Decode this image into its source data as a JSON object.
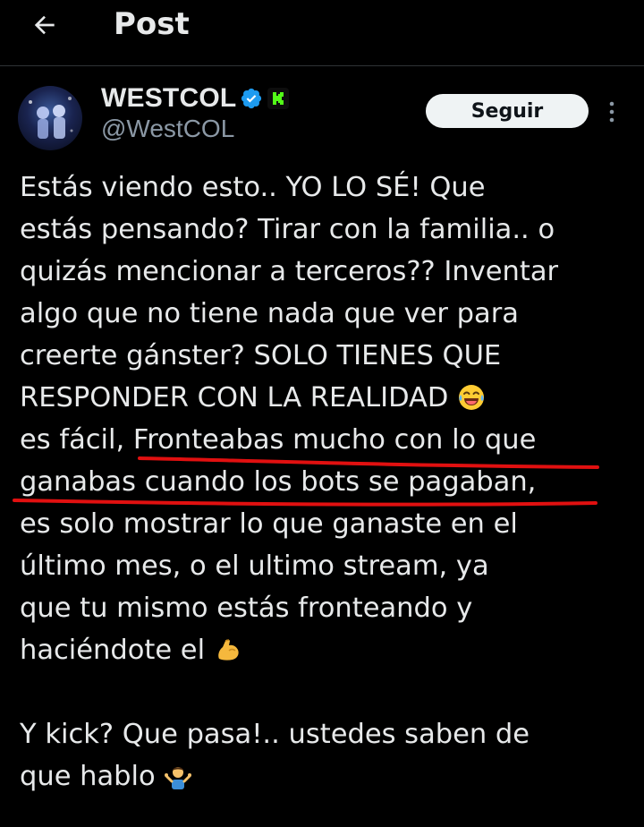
{
  "header": {
    "title": "Post"
  },
  "author": {
    "name": "WESTCOL",
    "handle": "@WestCOL",
    "follow_label": "Seguir"
  },
  "tweet": {
    "lines": [
      "Estás viendo esto.. YO LO SÉ! Que",
      "estás pensando? Tirar con la familia.. o",
      "quizás mencionar a terceros?? Inventar",
      "algo que no tiene nada que ver para",
      "creerte gánster? SOLO TIENES QUE",
      "RESPONDER CON LA REALIDAD",
      "es fácil, Fronteabas mucho con lo que",
      "ganabas cuando los bots se pagaban,",
      "es solo mostrar lo que ganaste en el",
      "último mes, o el ultimo stream, ya",
      "que tu mismo estás fronteando y",
      "haciéndote el",
      "",
      "Y kick? Que pasa!.. ustedes saben de",
      "que hablo"
    ]
  },
  "icons": {
    "back": "arrow-left-icon",
    "verified": "verified-badge-icon",
    "kick": "kick-logo-icon",
    "more": "more-vertical-icon",
    "emoji_laugh": "tears-of-joy-emoji",
    "emoji_muscle": "flexed-biceps-emoji",
    "emoji_shrug": "person-shrugging-emoji"
  },
  "colors": {
    "background": "#000000",
    "text": "#e7e9ea",
    "secondary_text": "#8b98a5",
    "verified_blue": "#1d9bf0",
    "kick_green": "#53fc18",
    "annotation_red": "#e11010"
  }
}
